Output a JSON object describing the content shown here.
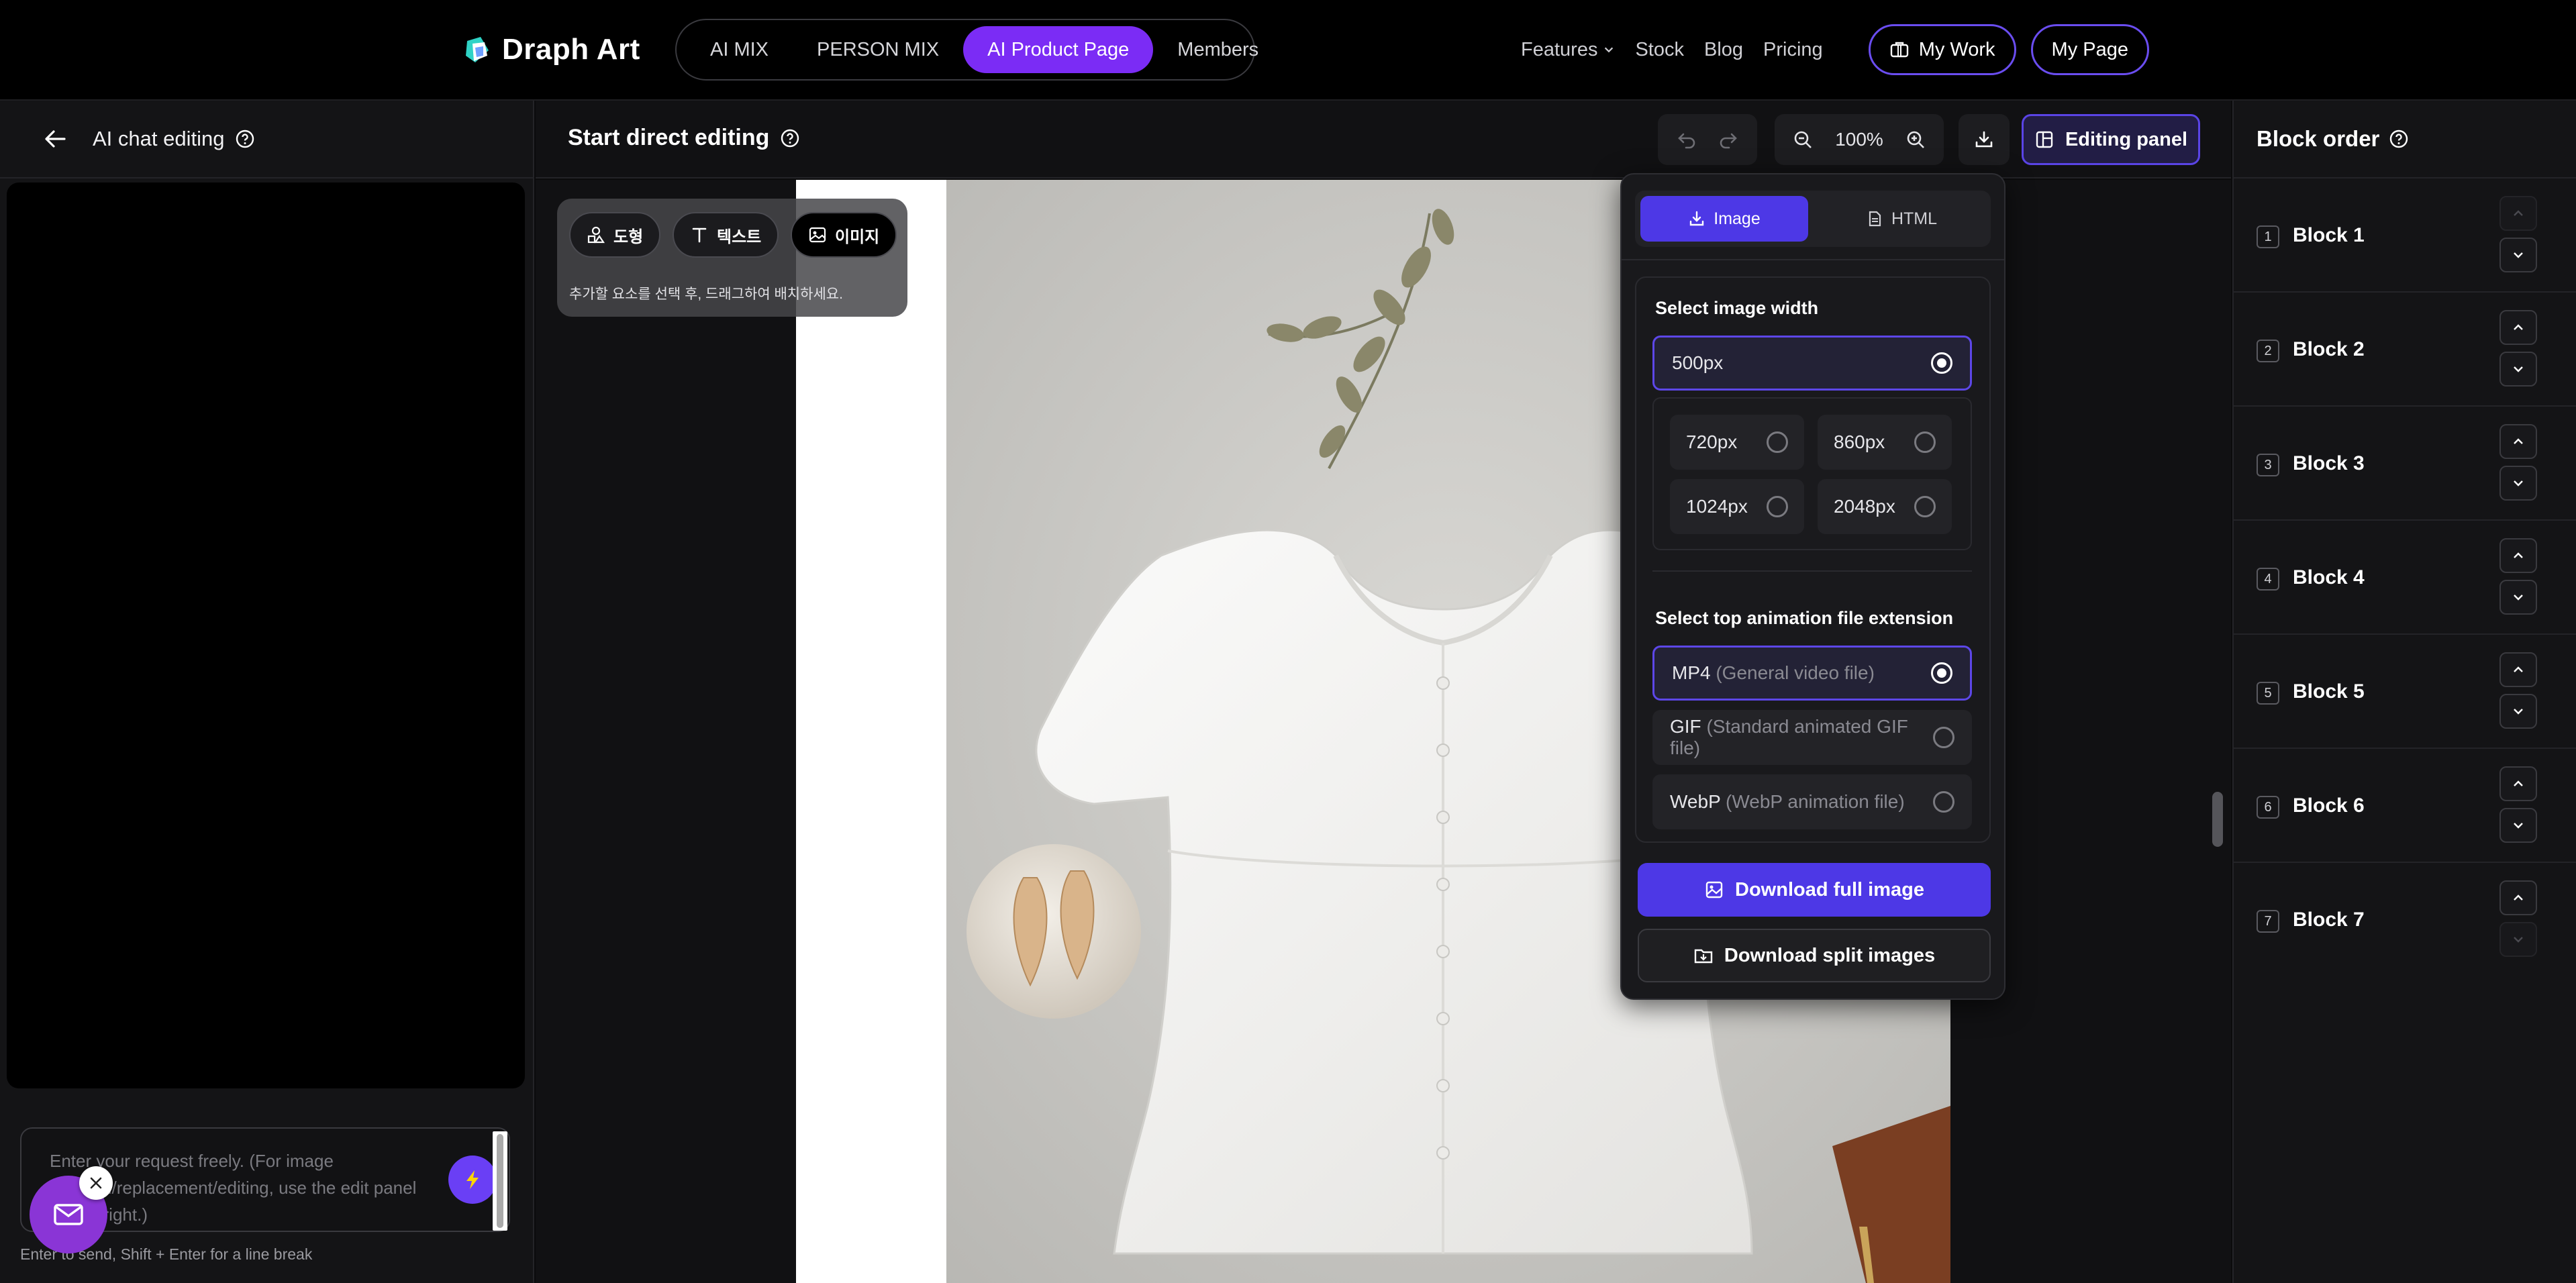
{
  "brand": {
    "name": "Draph Art"
  },
  "nav": {
    "tabs": [
      {
        "label": "AI MIX"
      },
      {
        "label": "PERSON MIX"
      },
      {
        "label": "AI Product Page"
      },
      {
        "label": "Members"
      }
    ],
    "active_tab": "AI Product Page",
    "links": {
      "features": "Features",
      "stock": "Stock",
      "blog": "Blog",
      "pricing": "Pricing"
    },
    "my_work": "My Work",
    "my_page": "My Page"
  },
  "left_panel": {
    "title": "AI chat editing",
    "input_placeholder": "Enter your request freely. (For image creation/replacement/editing, use the edit panel on the right.)",
    "hint": "Enter to send, Shift + Enter for a line break"
  },
  "center": {
    "title": "Start direct editing",
    "zoom": "100%",
    "editing_panel_label": "Editing panel"
  },
  "insert_toolbar": {
    "tabs": [
      {
        "label": "도형",
        "icon": "shapes-icon"
      },
      {
        "label": "텍스트",
        "icon": "text-icon"
      },
      {
        "label": "이미지",
        "icon": "image-icon"
      }
    ],
    "active_tab": "이미지",
    "hint": "추가할 요소를 선택 후, 드래그하여 배치하세요."
  },
  "download_panel": {
    "tabs": [
      {
        "label": "Image"
      },
      {
        "label": "HTML"
      }
    ],
    "active_tab": "Image",
    "width_title": "Select image width",
    "width_options": [
      {
        "label": "500px",
        "selected": true
      },
      {
        "label": "720px",
        "selected": false
      },
      {
        "label": "860px",
        "selected": false
      },
      {
        "label": "1024px",
        "selected": false
      },
      {
        "label": "2048px",
        "selected": false
      }
    ],
    "animation_title": "Select top animation file extension",
    "animation_options": [
      {
        "label": "MP4",
        "desc": "(General video file)",
        "selected": true
      },
      {
        "label": "GIF",
        "desc": "(Standard animated GIF file)",
        "selected": false
      },
      {
        "label": "WebP",
        "desc": "(WebP animation file)",
        "selected": false
      }
    ],
    "download_full": "Download full image",
    "download_split": "Download split images"
  },
  "right_panel": {
    "title": "Block order",
    "blocks": [
      {
        "number": "1",
        "label": "Block 1"
      },
      {
        "number": "2",
        "label": "Block 2"
      },
      {
        "number": "3",
        "label": "Block 3"
      },
      {
        "number": "4",
        "label": "Block 4"
      },
      {
        "number": "5",
        "label": "Block 5"
      },
      {
        "number": "6",
        "label": "Block 6"
      },
      {
        "number": "7",
        "label": "Block 7"
      }
    ]
  },
  "colors": {
    "accent_purple": "#7b2cf5",
    "accent_indigo": "#4d38e6",
    "background": "#0b0b0c",
    "panel": "#141416"
  }
}
